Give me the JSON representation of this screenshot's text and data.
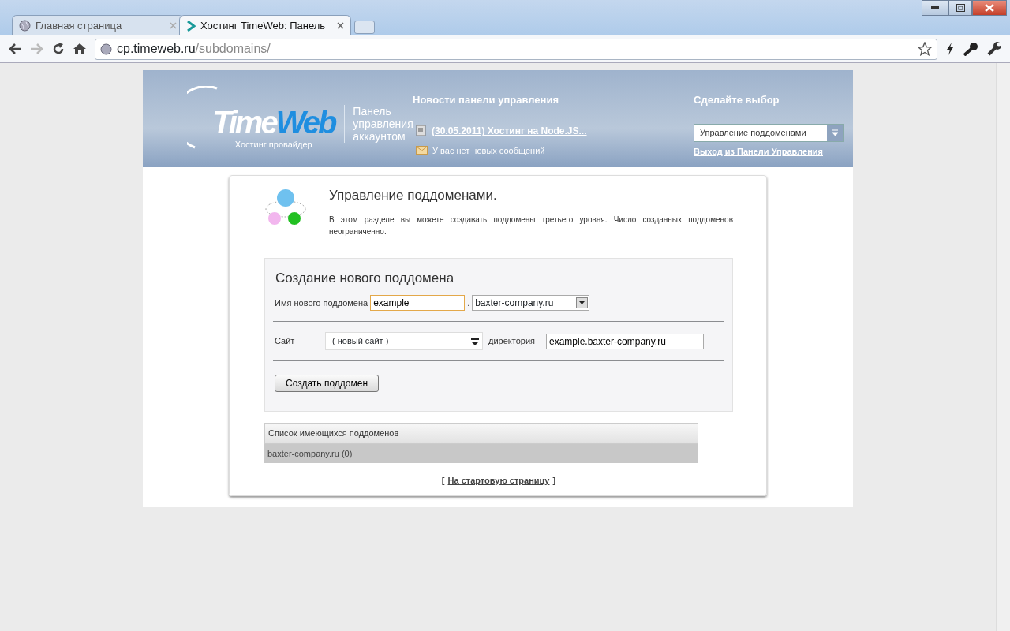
{
  "browser": {
    "tabs": [
      {
        "label": "Главная страница",
        "selected": false,
        "kind": "globe"
      },
      {
        "label": "Хостинг TimeWeb: Панель",
        "selected": true,
        "kind": "arrow"
      }
    ],
    "address": {
      "host": "cp.timeweb.ru",
      "path": "/subdomains/"
    }
  },
  "header": {
    "logo": {
      "main": "Time",
      "accent": "Web",
      "tagline": "Хостинг провайдер"
    },
    "panel_title": "Панель управления аккаунтом",
    "news": {
      "title": "Новости панели управления",
      "items": [
        {
          "kind": "news",
          "text": "(30.05.2011) Хостинг на Node.JS..."
        },
        {
          "kind": "mail",
          "text": "У вас нет новых сообщений"
        }
      ]
    },
    "choice": {
      "title": "Сделайте выбор",
      "select": "Управление поддоменами",
      "logout": "Выход из Панели Управления"
    }
  },
  "intro": {
    "title": "Управление поддоменами.",
    "text": "В этом разделе вы можете создавать поддомены третьего уровня. Число созданных поддоменов неограниченно."
  },
  "form": {
    "title": "Создание нового поддомена",
    "name_label": "Имя нового поддомена",
    "name_value": "example",
    "dot": ".",
    "domain": "baxter-company.ru",
    "site_label": "Сайт",
    "site": "( новый сайт )",
    "dir_label": "директория",
    "dir_value": "example.baxter-company.ru",
    "submit": "Создать поддомен"
  },
  "list": {
    "header": "Список имеющихся поддоменов",
    "rows": [
      "baxter-company.ru (0)"
    ]
  },
  "back": {
    "open": "[",
    "link": "На стартовую страницу",
    "close": "]"
  }
}
